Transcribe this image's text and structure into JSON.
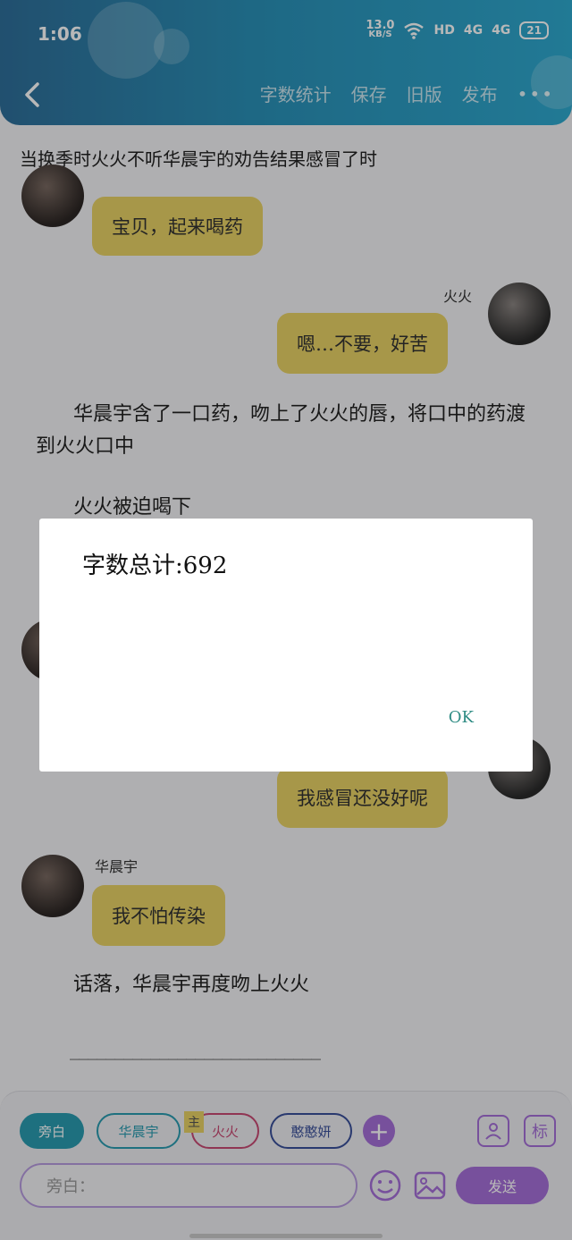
{
  "status_bar": {
    "time": "1:06",
    "speed_value": "13.0",
    "speed_unit": "KB/S",
    "hd": "HD",
    "net1": "4G",
    "net2": "4G",
    "battery": "21"
  },
  "toolbar": {
    "word_count": "字数统计",
    "save": "保存",
    "old_version": "旧版",
    "publish": "发布",
    "more": "•••"
  },
  "chapter_title": "当换季时火火不听华晨宇的劝告结果感冒了时",
  "chat": {
    "msg1": "宝贝，起来喝药",
    "sender_huohuo": "火火",
    "msg2": "嗯…不要，好苦",
    "narration1": "华晨宇含了一口药，吻上了火火的唇，将口中的药渡到火火口中",
    "narration2": "火火被迫喝下",
    "msg3": "我感冒还没好呢",
    "sender_hua": "华晨宇",
    "msg4": "我不怕传染",
    "narration3": "话落，华晨宇再度吻上火火",
    "divider": "____________________________"
  },
  "input_bar": {
    "chips": [
      "旁白",
      "华晨宇",
      "火火",
      "憨憨妍"
    ],
    "main_tag": "主",
    "add": "+",
    "mark": "标",
    "placeholder": "旁白：",
    "send": "发送"
  },
  "dialog": {
    "text": "字数总计:692",
    "ok": "OK"
  },
  "colors": {
    "header": "#2a91b8",
    "bubble": "#e8d166",
    "accent": "#a56fd8",
    "teal": "#2a9bb0"
  }
}
